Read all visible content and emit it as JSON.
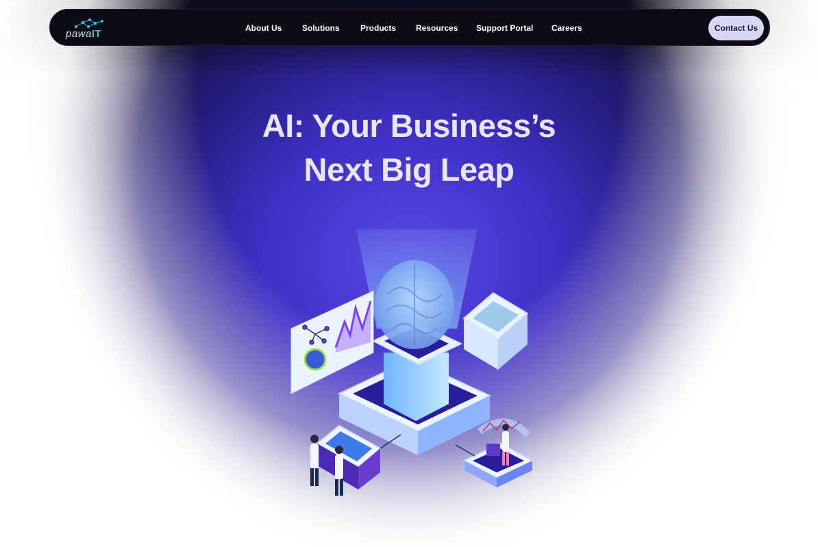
{
  "brand": {
    "logo_text_prefix": "pawa",
    "logo_text_suffix": "IT"
  },
  "nav": {
    "items": [
      {
        "label": "About Us"
      },
      {
        "label": "Solutions"
      },
      {
        "label": "Products"
      },
      {
        "label": "Resources"
      },
      {
        "label": "Support Portal"
      },
      {
        "label": "Careers"
      }
    ],
    "contact_label": "Contact Us"
  },
  "hero": {
    "headline_line1": "AI: Your Business’s",
    "headline_line2": "Next Big Leap"
  },
  "colors": {
    "nav_bg": "#0c0c14",
    "accent_blue": "#3fb7e0",
    "contact_bg": "#d9d8f4",
    "hero_purple": "#4a3bd6"
  }
}
